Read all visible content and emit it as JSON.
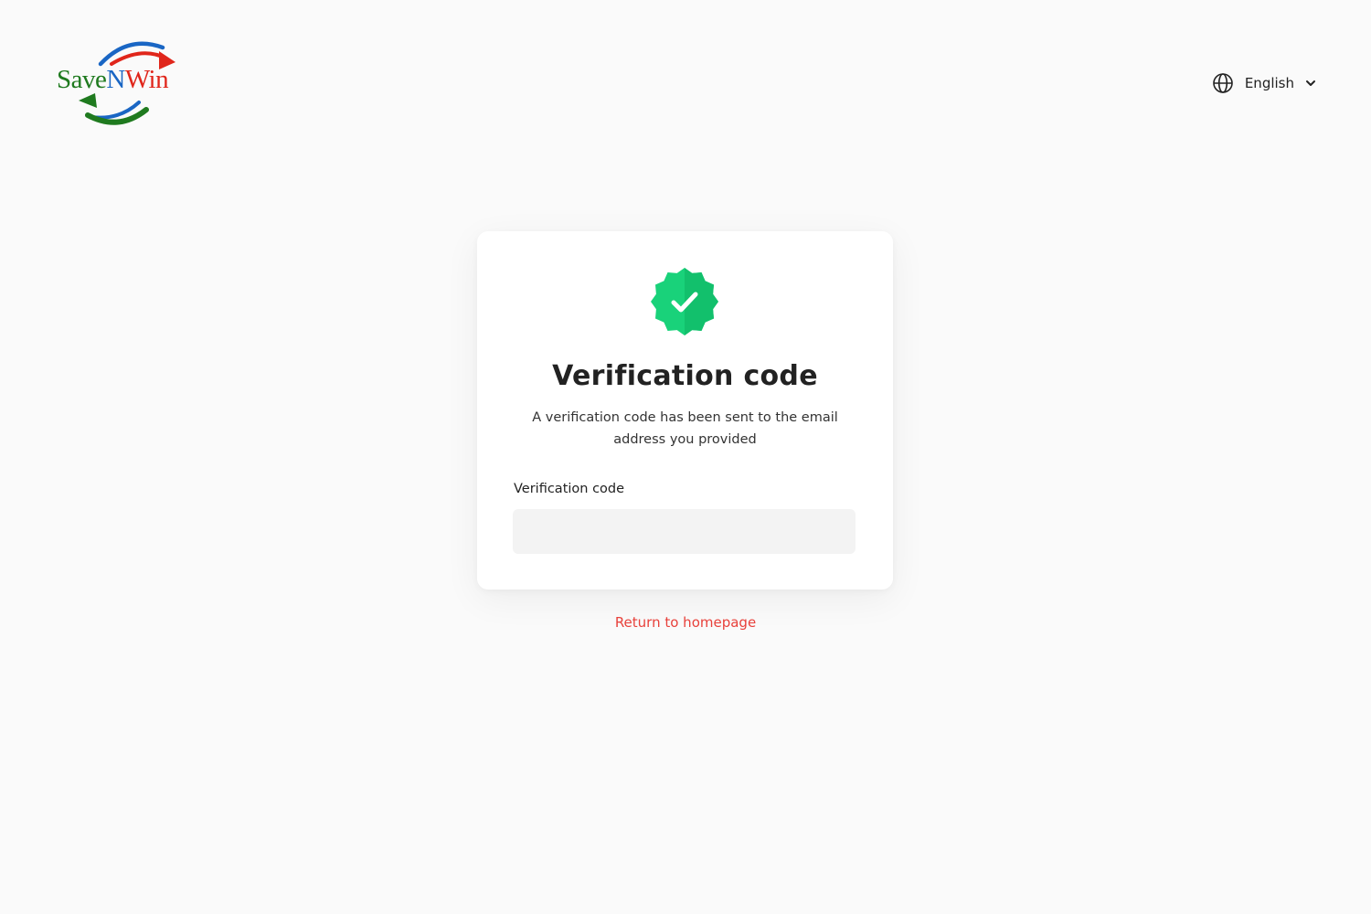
{
  "brand": {
    "logo_parts": [
      "Save",
      "N",
      "Win"
    ],
    "colors": {
      "green": "#1f7a1f",
      "blue": "#1a66c4",
      "red": "#e0261b"
    }
  },
  "header": {
    "language": {
      "label": "English",
      "icon": "globe-icon",
      "caret_icon": "chevron-down-icon"
    }
  },
  "card": {
    "badge_icon": "verified-badge-icon",
    "badge_color": "#19d27a",
    "title": "Verification code",
    "description": "A verification code has been sent to the email address you provided",
    "field_label": "Verification code",
    "input_value": "",
    "input_placeholder": ""
  },
  "footer": {
    "return_link": "Return to homepage",
    "link_color": "#e8413b"
  }
}
